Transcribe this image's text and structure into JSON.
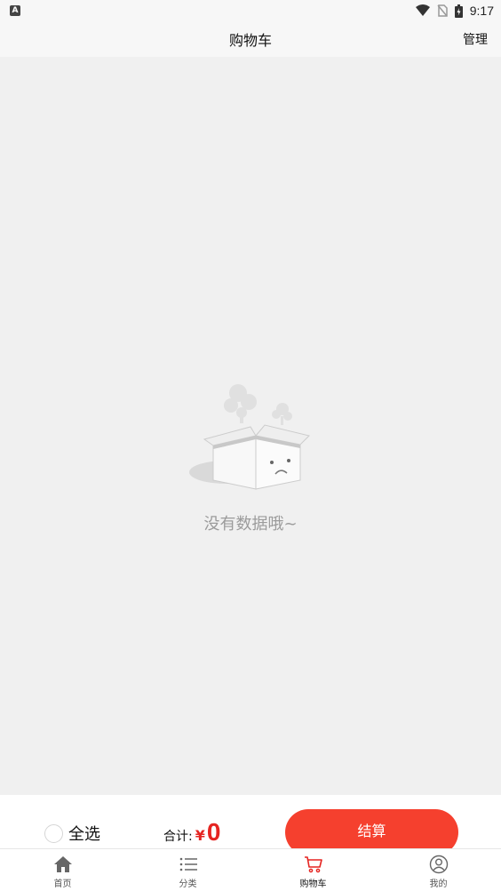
{
  "status_bar": {
    "app_badge": "A",
    "time": "9:17"
  },
  "header": {
    "title": "购物车",
    "manage_label": "管理"
  },
  "empty_state": {
    "message": "没有数据哦~"
  },
  "checkout": {
    "select_all_label": "全选",
    "total_label": "合计:",
    "currency": "¥",
    "amount": "0",
    "checkout_label": "结算"
  },
  "tabs": [
    {
      "label": "首页",
      "icon": "home-icon",
      "active": false
    },
    {
      "label": "分类",
      "icon": "list-icon",
      "active": false
    },
    {
      "label": "购物车",
      "icon": "cart-icon",
      "active": true
    },
    {
      "label": "我的",
      "icon": "user-icon",
      "active": false
    }
  ],
  "colors": {
    "accent": "#f5402e",
    "price": "#e52421",
    "background": "#f0f0f0"
  }
}
